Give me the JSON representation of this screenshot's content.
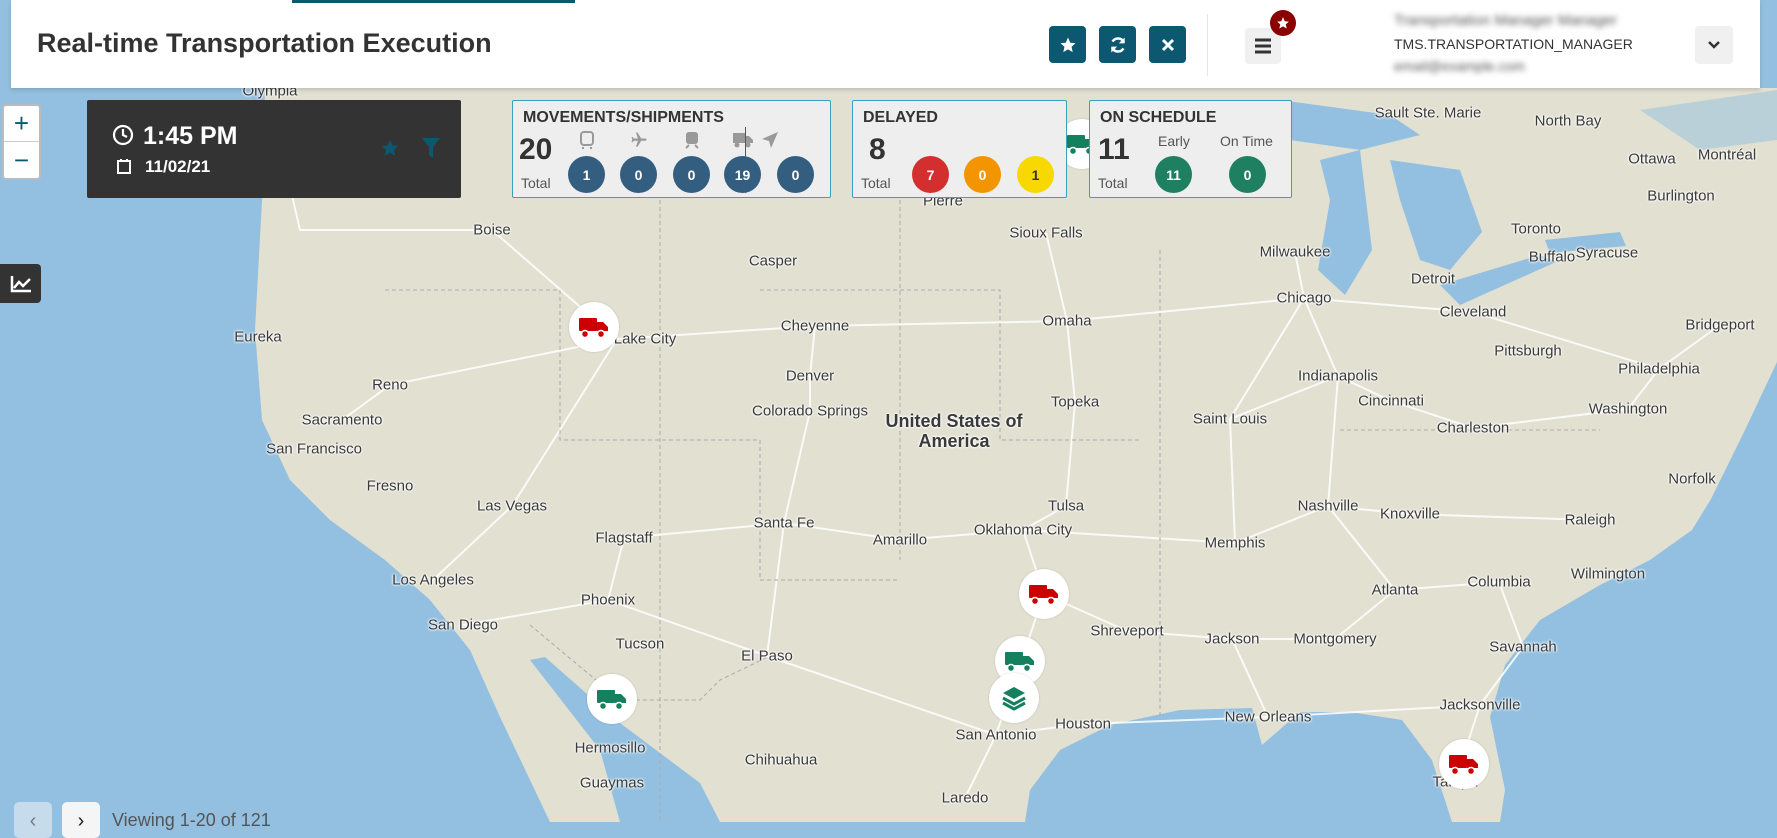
{
  "header": {
    "title": "Real-time Transportation Execution",
    "favorite_label": "Favorite",
    "refresh_label": "Refresh",
    "close_label": "Close"
  },
  "user": {
    "name": "Transportation Manager Manager",
    "role": "TMS.TRANSPORTATION_MANAGER",
    "email": "email@example.com"
  },
  "time_panel": {
    "time": "1:45 PM",
    "date": "11/02/21"
  },
  "movements": {
    "title": "MOVEMENTS/SHIPMENTS",
    "total": "20",
    "total_label": "Total",
    "counts": {
      "bus": "1",
      "air": "0",
      "rail": "0",
      "truck": "19",
      "other": "0"
    }
  },
  "delayed": {
    "title": "DELAYED",
    "total": "8",
    "total_label": "Total",
    "red": "7",
    "orange": "0",
    "yellow": "1"
  },
  "on_schedule": {
    "title": "ON SCHEDULE",
    "total": "11",
    "total_label": "Total",
    "early_label": "Early",
    "early": "11",
    "ontime_label": "On Time",
    "ontime": "0"
  },
  "colors": {
    "accent": "#0b5870",
    "count_blue": "#345e80",
    "red": "#d32f2f",
    "orange": "#f29500",
    "yellow": "#f7d800",
    "green": "#1e8060",
    "delayed_truck": "#cc0000",
    "ontime_truck": "#14805e",
    "water": "#93c0e0",
    "land": "#e1e0d1"
  },
  "map": {
    "country_label": "United States of America",
    "cities": [
      "Olympia",
      "Pierre",
      "Sault Ste. Marie",
      "North Bay",
      "Ottawa",
      "Montréal",
      "Burlington",
      "Boise",
      "Casper",
      "Sioux Falls",
      "Milwaukee",
      "Toronto",
      "Detroit",
      "Buffalo",
      "Syracuse",
      "Eureka",
      "Salt Lake City",
      "Cheyenne",
      "Omaha",
      "Chicago",
      "Cleveland",
      "Bridgeport",
      "Pittsburgh",
      "Reno",
      "Denver",
      "Indianapolis",
      "Philadelphia",
      "Sacramento",
      "Colorado Springs",
      "Topeka",
      "Saint Louis",
      "Cincinnati",
      "Washington",
      "Charleston",
      "San Francisco",
      "Fresno",
      "Norfolk",
      "Nashville",
      "Knoxville",
      "Las Vegas",
      "Tulsa",
      "Raleigh",
      "Flagstaff",
      "Santa Fe",
      "Amarillo",
      "Oklahoma City",
      "Memphis",
      "Atlanta",
      "Wilmington",
      "Los Angeles",
      "Columbia",
      "Phoenix",
      "Shreveport",
      "Montgomery",
      "Jackson",
      "San Diego",
      "Tucson",
      "El Paso",
      "Savannah",
      "Houston",
      "New Orleans",
      "Jacksonville",
      "San Antonio",
      "Hermosillo",
      "Chihuahua",
      "Guaymas",
      "Laredo",
      "Tampa"
    ],
    "markers": [
      {
        "icon": "truck",
        "status": "delayed"
      },
      {
        "icon": "truck",
        "status": "on-time"
      },
      {
        "icon": "truck",
        "status": "on-time"
      },
      {
        "icon": "truck",
        "status": "delayed"
      },
      {
        "icon": "truck",
        "status": "on-time"
      },
      {
        "icon": "layers",
        "status": "on-time"
      },
      {
        "icon": "truck",
        "status": "delayed"
      }
    ]
  },
  "pagination": {
    "text": "Viewing 1-20 of 121"
  }
}
